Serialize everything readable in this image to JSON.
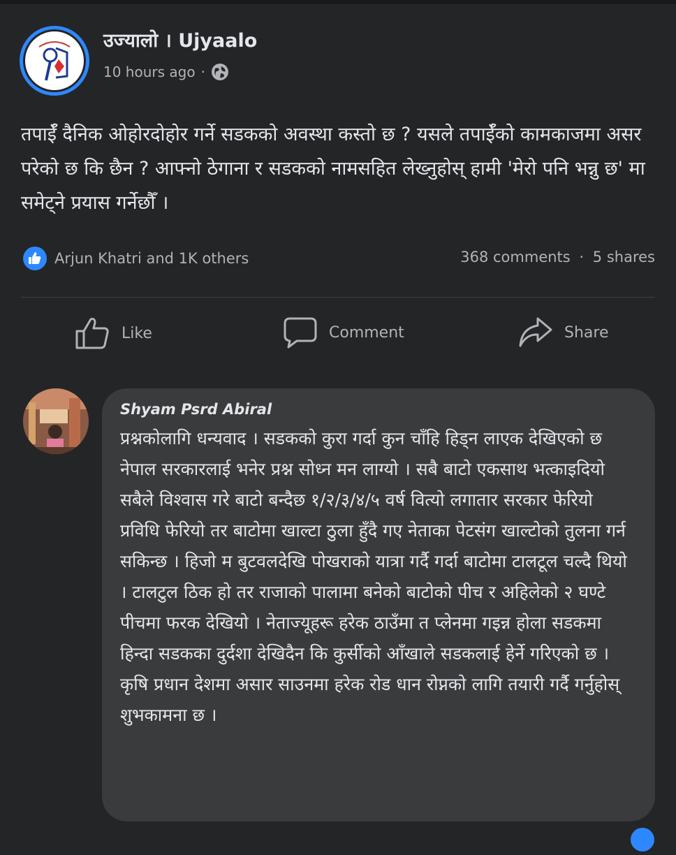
{
  "post": {
    "page_name": "उज्यालो । Ujyaalo",
    "time": "10 hours ago",
    "separator": "·",
    "privacy_icon": "globe-icon",
    "text": "तपाईँ दैनिक ओहोरदोहोर गर्ने सडकको अवस्था कस्तो छ ? यसले तपाईँको कामकाजमा असर परेको छ कि छैन ? आफ्नो ठेगाना र सडकको नामसहित लेख्नुहोस् हामी 'मेरो पनि भन्नु छ' मा समेट्ने प्रयास गर्नेछौँ ।"
  },
  "reactions": {
    "icon": "like-icon",
    "text": "Arjun Khatri and 1K others",
    "comments": "368 comments",
    "separator": "·",
    "shares": "5 shares"
  },
  "actions": {
    "like": "Like",
    "comment": "Comment",
    "share": "Share"
  },
  "comment": {
    "author": "Shyam Psrd Abiral",
    "paragraph1": "प्रश्नकोलागि धन्यवाद । सडकको कुरा गर्दा कुन चाँहि हिड्न लाएक देखिएको छ नेपाल सरकारलाई भनेर प्रश्न सोध्न मन लाग्यो । सबै बाटो एकसाथ भत्काइदियो सबैले विश्वास गरे बाटो बन्दैछ १/२/३/४/५ वर्ष वित्यो लगातार सरकार फेरियो प्रविधि फेरियो तर बाटोमा खाल्टा ठुला हुँदै गए  नेताका पेटसंग खाल्टोको तुलना गर्न सकिन्छ । हिजो म बुटवलदेखि पोखराको यात्रा गर्दै गर्दा बाटोमा टालटूल चल्दै थियो । टालटुल ठिक हो तर राजाको पालामा बनेको बाटोको पीच र अहिलेको २ घण्टे पीचमा फरक देखियो । नेताज्यूहरू हरेक ठाउँमा त प्लेनमा गइन्न होला सडकमा हिन्दा सडकका दुर्दशा देखिदैन कि कुर्सीको आँखाले सडकलाई हेर्ने गरिएको छ ।",
    "paragraph2": "कृषि प्रधान देशमा असार साउनमा हरेक रोड धान रोप्नको लागि तयारी गर्दै गर्नुहोस् शुभकामना छ ।"
  },
  "colors": {
    "background": "#242526",
    "bubble": "#3a3b3c",
    "accent": "#2d88ff",
    "primary_text": "#e4e6eb",
    "secondary_text": "#b0b3b8"
  }
}
